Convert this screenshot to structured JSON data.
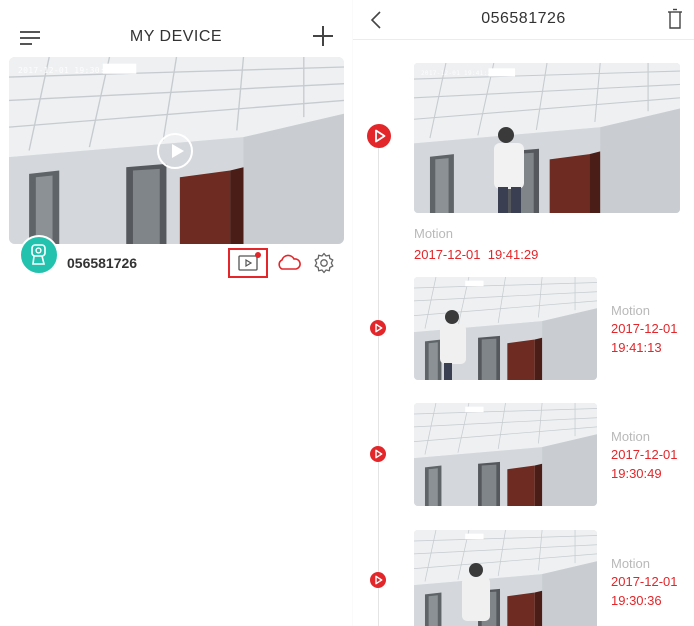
{
  "left_pane": {
    "title": "MY DEVICE",
    "camera_osd": "2017-12-01 19:30:17",
    "device_name": "056581726"
  },
  "right_pane": {
    "title": "056581726",
    "events": [
      {
        "type": "Motion",
        "time": "2017-12-01  19:41:29",
        "osd": "2017-12-01 19:41:29"
      },
      {
        "type": "Motion",
        "date": "2017-12-01",
        "time": "19:41:13"
      },
      {
        "type": "Motion",
        "date": "2017-12-01",
        "time": "19:30:49"
      },
      {
        "type": "Motion",
        "date": "2017-12-01",
        "time": "19:30:36"
      }
    ]
  },
  "colors": {
    "accent": "#e2262a",
    "teal": "#22c2ae",
    "muted_text": "#b9b9b9"
  },
  "icons": [
    "menu-icon",
    "add-icon",
    "play-icon",
    "camera-icon",
    "playback-icon",
    "cloud-icon",
    "gear-icon",
    "back-icon",
    "trash-icon"
  ]
}
